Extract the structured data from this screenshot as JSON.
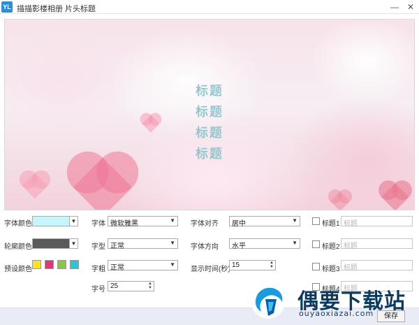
{
  "window": {
    "app_logo": "YL",
    "title": "描描影楼相册 片头标题",
    "minimize_icon": "minimize-icon",
    "close_icon": "close-icon"
  },
  "preview": {
    "titles": [
      "标题",
      "标题",
      "标题",
      "标题"
    ]
  },
  "colors": {
    "font_color_label": "字体颜色",
    "font_color": "#c6f6fa",
    "outline_color_label": "轮廓颜色",
    "outline_color": "#5a5a5a",
    "preset_label": "预设颜色",
    "presets": [
      "#f7e61c",
      "#e7337a",
      "#8cc63e",
      "#29c7d5"
    ]
  },
  "font": {
    "family_label": "字体",
    "family_value": "微软雅黑",
    "style_label": "字型",
    "style_value": "正常",
    "weight_label": "字粗",
    "weight_value": "正常",
    "size_label": "字号",
    "size_value": "25"
  },
  "layout": {
    "align_label": "字体对齐",
    "align_value": "居中",
    "direction_label": "字体方向",
    "direction_value": "水平",
    "duration_label": "显示时间(秒)",
    "duration_value": "15"
  },
  "title_fields": [
    {
      "label": "标题1",
      "placeholder": "标题"
    },
    {
      "label": "标题2",
      "placeholder": "标题"
    },
    {
      "label": "标题3",
      "placeholder": "标题"
    },
    {
      "label": "标题4",
      "placeholder": "标题"
    }
  ],
  "footer": {
    "save_label": "保存"
  },
  "watermark": {
    "brand": "偶要下载站",
    "url": "ouyaoxiazai.com"
  }
}
